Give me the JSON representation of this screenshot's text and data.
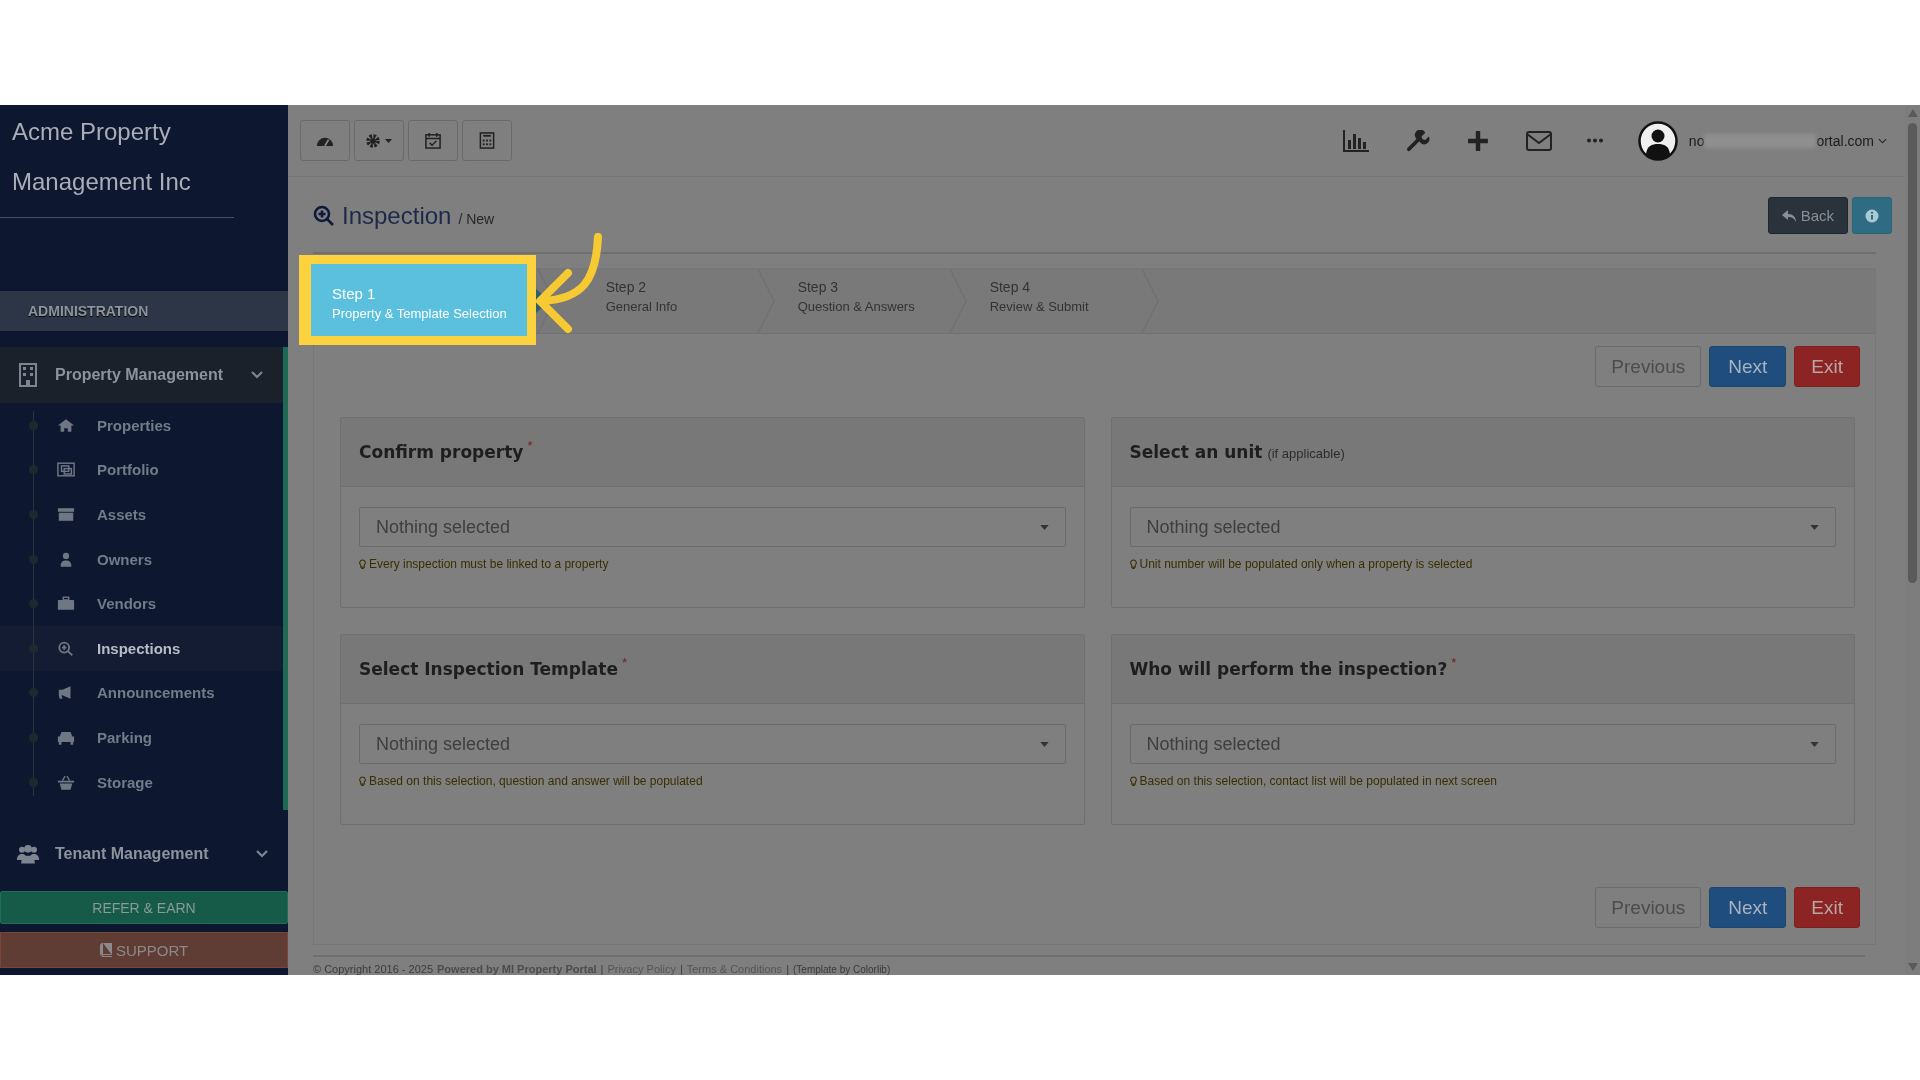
{
  "sidebar": {
    "company": "Acme Property Management Inc",
    "section_label": "ADMINISTRATION",
    "groups": [
      {
        "label": "Property Management",
        "kind": "building",
        "expanded": true,
        "items": [
          {
            "label": "Properties",
            "kind": "home",
            "selected": false
          },
          {
            "label": "Portfolio",
            "kind": "portfolio",
            "selected": false
          },
          {
            "label": "Assets",
            "kind": "archive",
            "selected": false
          },
          {
            "label": "Owners",
            "kind": "user",
            "selected": false
          },
          {
            "label": "Vendors",
            "kind": "briefcase",
            "selected": false
          },
          {
            "label": "Inspections",
            "kind": "search",
            "selected": true
          },
          {
            "label": "Announcements",
            "kind": "megaphone",
            "selected": false
          },
          {
            "label": "Parking",
            "kind": "car",
            "selected": false
          },
          {
            "label": "Storage",
            "kind": "basket",
            "selected": false
          }
        ]
      },
      {
        "label": "Tenant Management",
        "kind": "users",
        "expanded": false
      }
    ],
    "refer_button": "REFER & EARN",
    "support_button": "SUPPORT"
  },
  "topbar": {
    "user_start": "no",
    "user_end": "ortal.com"
  },
  "page": {
    "title": "Inspection",
    "breadcrumb": "/ New",
    "back_button": "Back"
  },
  "steps": [
    {
      "number": "Step 1",
      "label": "Property & Template Selection",
      "selected": true
    },
    {
      "number": "Step 2",
      "label": "General Info",
      "selected": false
    },
    {
      "number": "Step 3",
      "label": "Question & Answers",
      "selected": false
    },
    {
      "number": "Step 4",
      "label": "Review & Submit",
      "selected": false
    }
  ],
  "actions": {
    "previous": "Previous",
    "next": "Next",
    "exit": "Exit"
  },
  "cards": [
    {
      "title": "Confirm property",
      "required": true,
      "placeholder": "Nothing selected",
      "hint": "Every inspection must be linked to a property"
    },
    {
      "title": "Select an unit",
      "required": false,
      "note": "(if applicable)",
      "placeholder": "Nothing selected",
      "hint": "Unit number will be populated only when a property is selected"
    },
    {
      "title": "Select Inspection Template",
      "required": true,
      "placeholder": "Nothing selected",
      "hint": "Based on this selection, question and answer will be populated"
    },
    {
      "title": "Who will perform the inspection?",
      "required": true,
      "placeholder": "Nothing selected",
      "hint": "Based on this selection, contact list will be populated in next screen"
    }
  ],
  "required_mark": "*",
  "bottom_actions": {
    "previous": "Previous",
    "next": "Next",
    "exit": "Exit"
  },
  "footer": {
    "copyright": "© Copyright 2016 - 2025",
    "powered": "Powered by MI Property Portal",
    "separator": "|",
    "privacy": "Privacy Policy",
    "terms": "Terms & Conditions",
    "template": "(Template by Colorlib)"
  }
}
